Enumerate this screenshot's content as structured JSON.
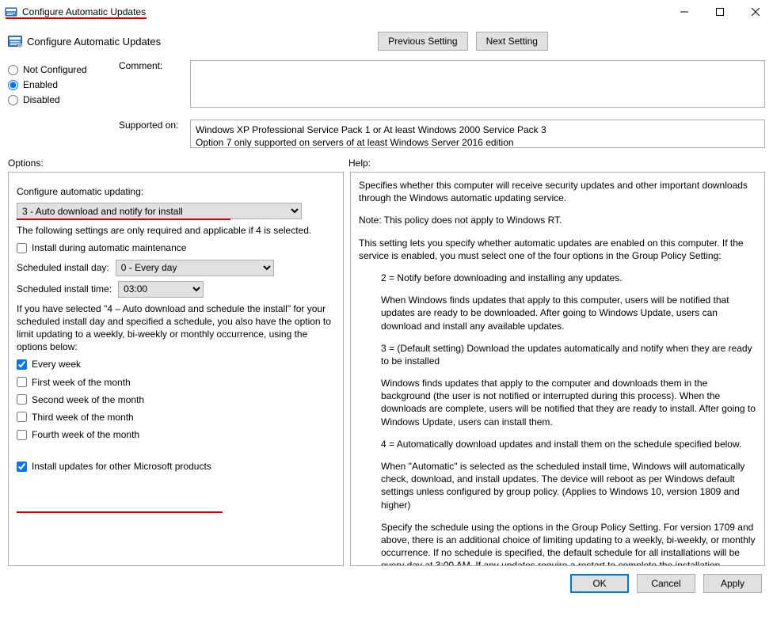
{
  "window": {
    "title": "Configure Automatic Updates"
  },
  "header": {
    "title": "Configure Automatic Updates",
    "prev_btn": "Previous Setting",
    "next_btn": "Next Setting"
  },
  "state_radios": {
    "not_configured": "Not Configured",
    "enabled": "Enabled",
    "disabled": "Disabled",
    "selected": "enabled"
  },
  "labels": {
    "comment": "Comment:",
    "supported_on": "Supported on:",
    "options": "Options:",
    "help": "Help:"
  },
  "supported_text_line1": "Windows XP Professional Service Pack 1 or At least Windows 2000 Service Pack 3",
  "supported_text_line2": "Option 7 only supported on servers of at least Windows Server 2016 edition",
  "options": {
    "configure_label": "Configure automatic updating:",
    "configure_value": "3 - Auto download and notify for install",
    "note_required": "The following settings are only required and applicable if 4 is selected.",
    "install_maintenance": "Install during automatic maintenance",
    "sched_day_label": "Scheduled install day:",
    "sched_day_value": "0 - Every day",
    "sched_time_label": "Scheduled install time:",
    "sched_time_value": "03:00",
    "explain_text": "If you have selected \"4 – Auto download and schedule the install\" for your scheduled install day and specified a schedule, you also have the option to limit updating to a weekly, bi-weekly or monthly occurrence, using the options below:",
    "chk_every_week": "Every week",
    "chk_first_week": "First week of the month",
    "chk_second_week": "Second week of the month",
    "chk_third_week": "Third week of the month",
    "chk_fourth_week": "Fourth week of the month",
    "chk_other_products": "Install updates for other Microsoft products"
  },
  "help_paragraphs": [
    "Specifies whether this computer will receive security updates and other important downloads through the Windows automatic updating service.",
    "Note: This policy does not apply to Windows RT.",
    "This setting lets you specify whether automatic updates are enabled on this computer. If the service is enabled, you must select one of the four options in the Group Policy Setting:",
    "2 = Notify before downloading and installing any updates.",
    "When Windows finds updates that apply to this computer, users will be notified that updates are ready to be downloaded. After going to Windows Update, users can download and install any available updates.",
    "3 = (Default setting) Download the updates automatically and notify when they are ready to be installed",
    "Windows finds updates that apply to the computer and downloads them in the background (the user is not notified or interrupted during this process). When the downloads are complete, users will be notified that they are ready to install. After going to Windows Update, users can install them.",
    "4 = Automatically download updates and install them on the schedule specified below.",
    "When \"Automatic\" is selected as the scheduled install time, Windows will automatically check, download, and install updates. The device will reboot as per Windows default settings unless configured by group policy. (Applies to Windows 10, version 1809 and higher)",
    "Specify the schedule using the options in the Group Policy Setting. For version 1709 and above, there is an additional choice of limiting updating to a weekly, bi-weekly, or monthly occurrence. If no schedule is specified, the default schedule for all installations will be every day at 3:00 AM. If any updates require a restart to complete the installation, Windows will restart the"
  ],
  "indented_help": [
    3,
    4,
    5,
    6,
    7,
    8,
    9
  ],
  "footer": {
    "ok": "OK",
    "cancel": "Cancel",
    "apply": "Apply"
  }
}
